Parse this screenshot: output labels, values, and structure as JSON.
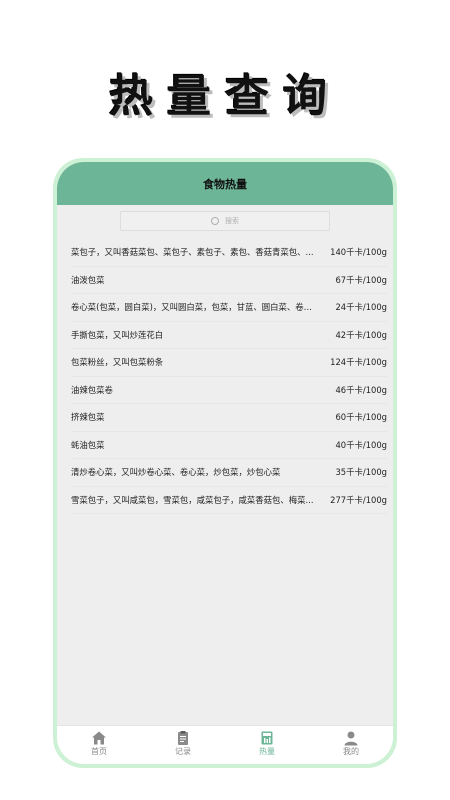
{
  "promo": {
    "title": "热量查询"
  },
  "header": {
    "title": "食物热量"
  },
  "search": {
    "placeholder": "搜索"
  },
  "foods": [
    {
      "name": "菜包子，又叫香菇菜包、菜包子、素包子、素包、香菇青菜包、...",
      "cal": "140千卡/100g"
    },
    {
      "name": "油泼包菜",
      "cal": "67千卡/100g"
    },
    {
      "name": "卷心菜(包菜，圆白菜)，又叫圆白菜，包菜，甘蓝、圆白菜、卷心...",
      "cal": "24千卡/100g"
    },
    {
      "name": "手撕包菜，又叫炒莲花白",
      "cal": "42千卡/100g"
    },
    {
      "name": "包菜粉丝，又叫包菜粉条",
      "cal": "124千卡/100g"
    },
    {
      "name": "油辣包菜卷",
      "cal": "46千卡/100g"
    },
    {
      "name": "挤辣包菜",
      "cal": "60千卡/100g"
    },
    {
      "name": "蚝油包菜",
      "cal": "40千卡/100g"
    },
    {
      "name": "清炒卷心菜，又叫炒卷心菜、卷心菜，炒包菜，炒包心菜",
      "cal": "35千卡/100g"
    },
    {
      "name": "雪菜包子，又叫咸菜包，雪菜包，咸菜包子，咸菜香菇包、梅菜...",
      "cal": "277千卡/100g"
    }
  ],
  "tabs": [
    {
      "label": "首页",
      "icon": "home-icon"
    },
    {
      "label": "记录",
      "icon": "clipboard-icon"
    },
    {
      "label": "热量",
      "icon": "calorie-icon"
    },
    {
      "label": "我的",
      "icon": "person-icon"
    }
  ],
  "colors": {
    "accent": "#6db597",
    "frame": "#cdf1d5",
    "background": "#eeeeee"
  }
}
